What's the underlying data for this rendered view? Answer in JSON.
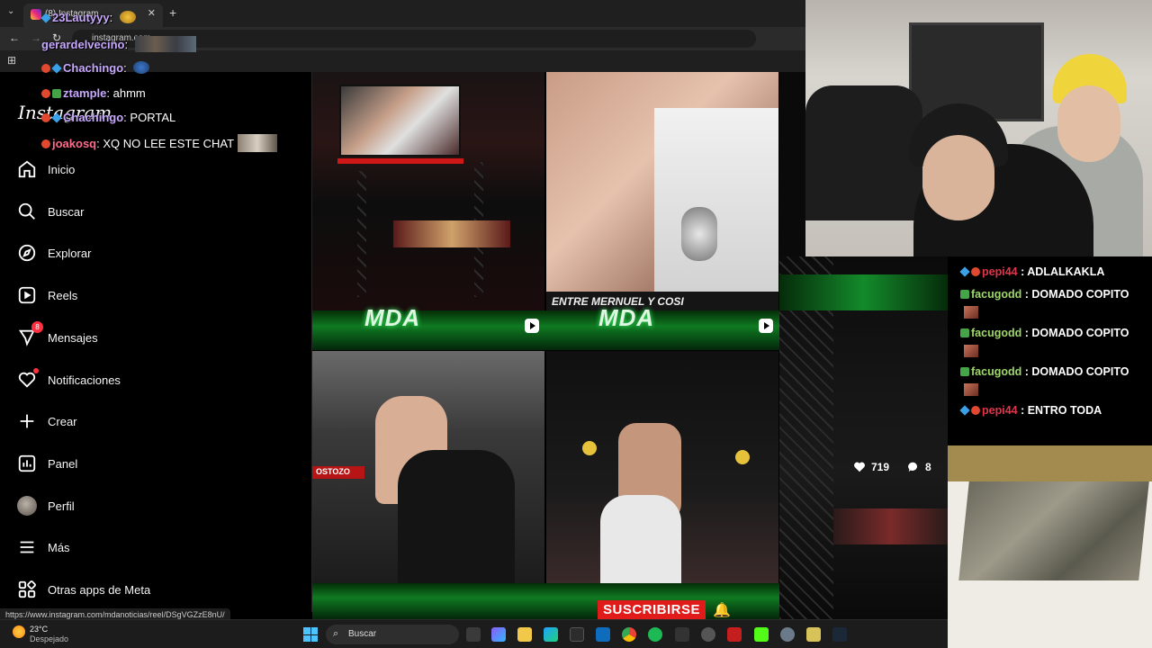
{
  "browser": {
    "tab_title": "(8) Instagram",
    "url": "instagram.com"
  },
  "sidebar": {
    "logo": "Instagram",
    "items": [
      {
        "label": "Inicio",
        "icon": "home-icon"
      },
      {
        "label": "Buscar",
        "icon": "search-icon"
      },
      {
        "label": "Explorar",
        "icon": "compass-icon"
      },
      {
        "label": "Reels",
        "icon": "reels-icon"
      },
      {
        "label": "Mensajes",
        "icon": "messenger-icon",
        "badge": "8"
      },
      {
        "label": "Notificaciones",
        "icon": "heart-icon"
      },
      {
        "label": "Crear",
        "icon": "plus-icon"
      },
      {
        "label": "Panel",
        "icon": "chart-icon"
      },
      {
        "label": "Perfil",
        "icon": "avatar"
      },
      {
        "label": "Más",
        "icon": "menu-icon"
      },
      {
        "label": "Otras apps de Meta",
        "icon": "meta-apps-icon"
      }
    ]
  },
  "overlay_chat": [
    {
      "user": "23Lautyyy",
      "msg": ""
    },
    {
      "user": "gerardelvecino",
      "msg": ""
    },
    {
      "user": "Chachingo",
      "msg": ""
    },
    {
      "user": "ztample",
      "msg": "ahmm"
    },
    {
      "user": "Chachingo",
      "msg": "PORTAL"
    },
    {
      "user": "joakosq",
      "msg": "XQ NO LEE ESTE CHAT"
    }
  ],
  "feed": {
    "overlay_texts": [
      "MDA",
      "MDA"
    ],
    "caption": "ENTRE MERNUEL Y COSI",
    "small_text": "OSTOZO"
  },
  "reel": {
    "likes": "719",
    "comments": "8"
  },
  "stream_chat": [
    {
      "user": "pepi44",
      "msg": "ADLALKAKLA",
      "kind": "red"
    },
    {
      "user": "facugodd",
      "msg": "DOMADO COPITO",
      "kind": "green"
    },
    {
      "user": "facugodd",
      "msg": "DOMADO COPITO",
      "kind": "green"
    },
    {
      "user": "facugodd",
      "msg": "DOMADO COPITO",
      "kind": "green"
    },
    {
      "user": "pepi44",
      "msg": "ENTRO TODA",
      "kind": "red"
    }
  ],
  "status_url": "https://www.instagram.com/mdanoticias/reel/DSgVGZzE8nU/",
  "subscribe_label": "SUSCRIBIRSE",
  "taskbar": {
    "temp": "23°C",
    "weather": "Despejado",
    "search_label": "Buscar"
  }
}
